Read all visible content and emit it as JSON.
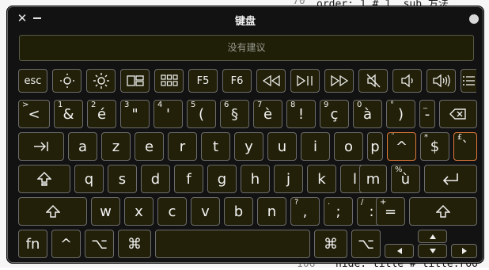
{
  "window": {
    "title": "键盘",
    "suggestion_placeholder": "没有建议"
  },
  "background": {
    "lines": [
      {
        "text": "order: 1 # 1, sub 方法",
        "kind": "code"
      },
      {
        "text": "hide: title # title.roo",
        "kind": "code"
      },
      {
        "text": "106",
        "kind": "linenum"
      },
      {
        "text": "70",
        "kind": "linenum"
      }
    ]
  },
  "rows": {
    "function_row": [
      "esc",
      "F5",
      "F6"
    ],
    "number_row": [
      {
        "sub": ">",
        "main": "<"
      },
      {
        "sub": "1",
        "main": "&"
      },
      {
        "sub": "2",
        "main": "é"
      },
      {
        "sub": "3",
        "main": "\""
      },
      {
        "sub": "4",
        "main": "'"
      },
      {
        "sub": "5",
        "main": "("
      },
      {
        "sub": "6",
        "main": "§"
      },
      {
        "sub": "7",
        "main": "è"
      },
      {
        "sub": "8",
        "main": "!"
      },
      {
        "sub": "9",
        "main": "ç"
      },
      {
        "sub": "0",
        "main": "à"
      },
      {
        "sub": "°",
        "main": ")"
      },
      {
        "sub": "_",
        "main": "-"
      }
    ],
    "top_row": [
      "a",
      "z",
      "e",
      "r",
      "t",
      "y",
      "u",
      "i",
      "o",
      "p"
    ],
    "top_row_extra": [
      {
        "sub": "¨",
        "main": "^"
      },
      {
        "sub": "*",
        "main": "$"
      },
      {
        "sub": "£",
        "main": "`"
      }
    ],
    "home_row": [
      "q",
      "s",
      "d",
      "f",
      "g",
      "h",
      "j",
      "k",
      "l",
      "m"
    ],
    "home_row_extra": {
      "sub": "%",
      "main": "ù"
    },
    "bottom_row": [
      "w",
      "x",
      "c",
      "v",
      "b",
      "n"
    ],
    "bottom_row_extra": [
      {
        "sub": "?",
        "main": ","
      },
      {
        "sub": ".",
        "main": ";"
      },
      {
        "sub": "/",
        "main": ":"
      },
      {
        "sub": "+",
        "main": "="
      }
    ],
    "modifier_row": {
      "fn": "fn",
      "ctrl": "^",
      "option": "⌥",
      "command": "⌘"
    }
  },
  "colors": {
    "highlight": "#e07a3a",
    "key_bg": "#222008",
    "key_border": "#6d6d6d"
  }
}
